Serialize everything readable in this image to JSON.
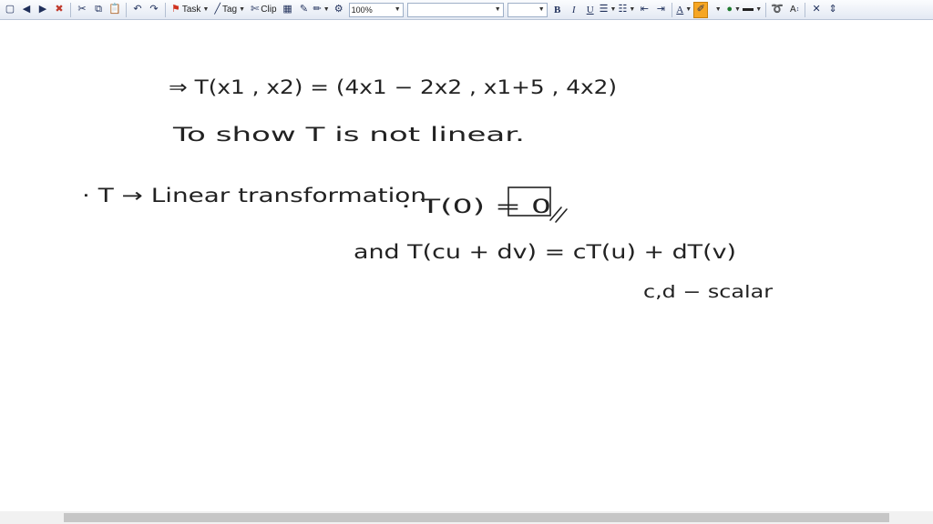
{
  "toolbar": {
    "task_label": "Task",
    "tag_label": "Tag",
    "clip_label": "Clip",
    "zoom_value": "100%",
    "font_name_value": "",
    "font_size_value": "",
    "bold_label": "B",
    "italic_label": "I",
    "underline_label": "U",
    "font_color_glyph": "A",
    "superscript_label": "A",
    "highlight_color": "#f6a623"
  },
  "page": {
    "lines": [
      "⇒ T(x1 , x2) = (4x1 − 2x2 , x1+5 , 4x2)",
      "To show T is not linear.",
      "· T → Linear transformation",
      "· T(0) = 0",
      "and  T(cu + dv) = cT(u) + dT(v)",
      "c,d − scalar"
    ]
  }
}
